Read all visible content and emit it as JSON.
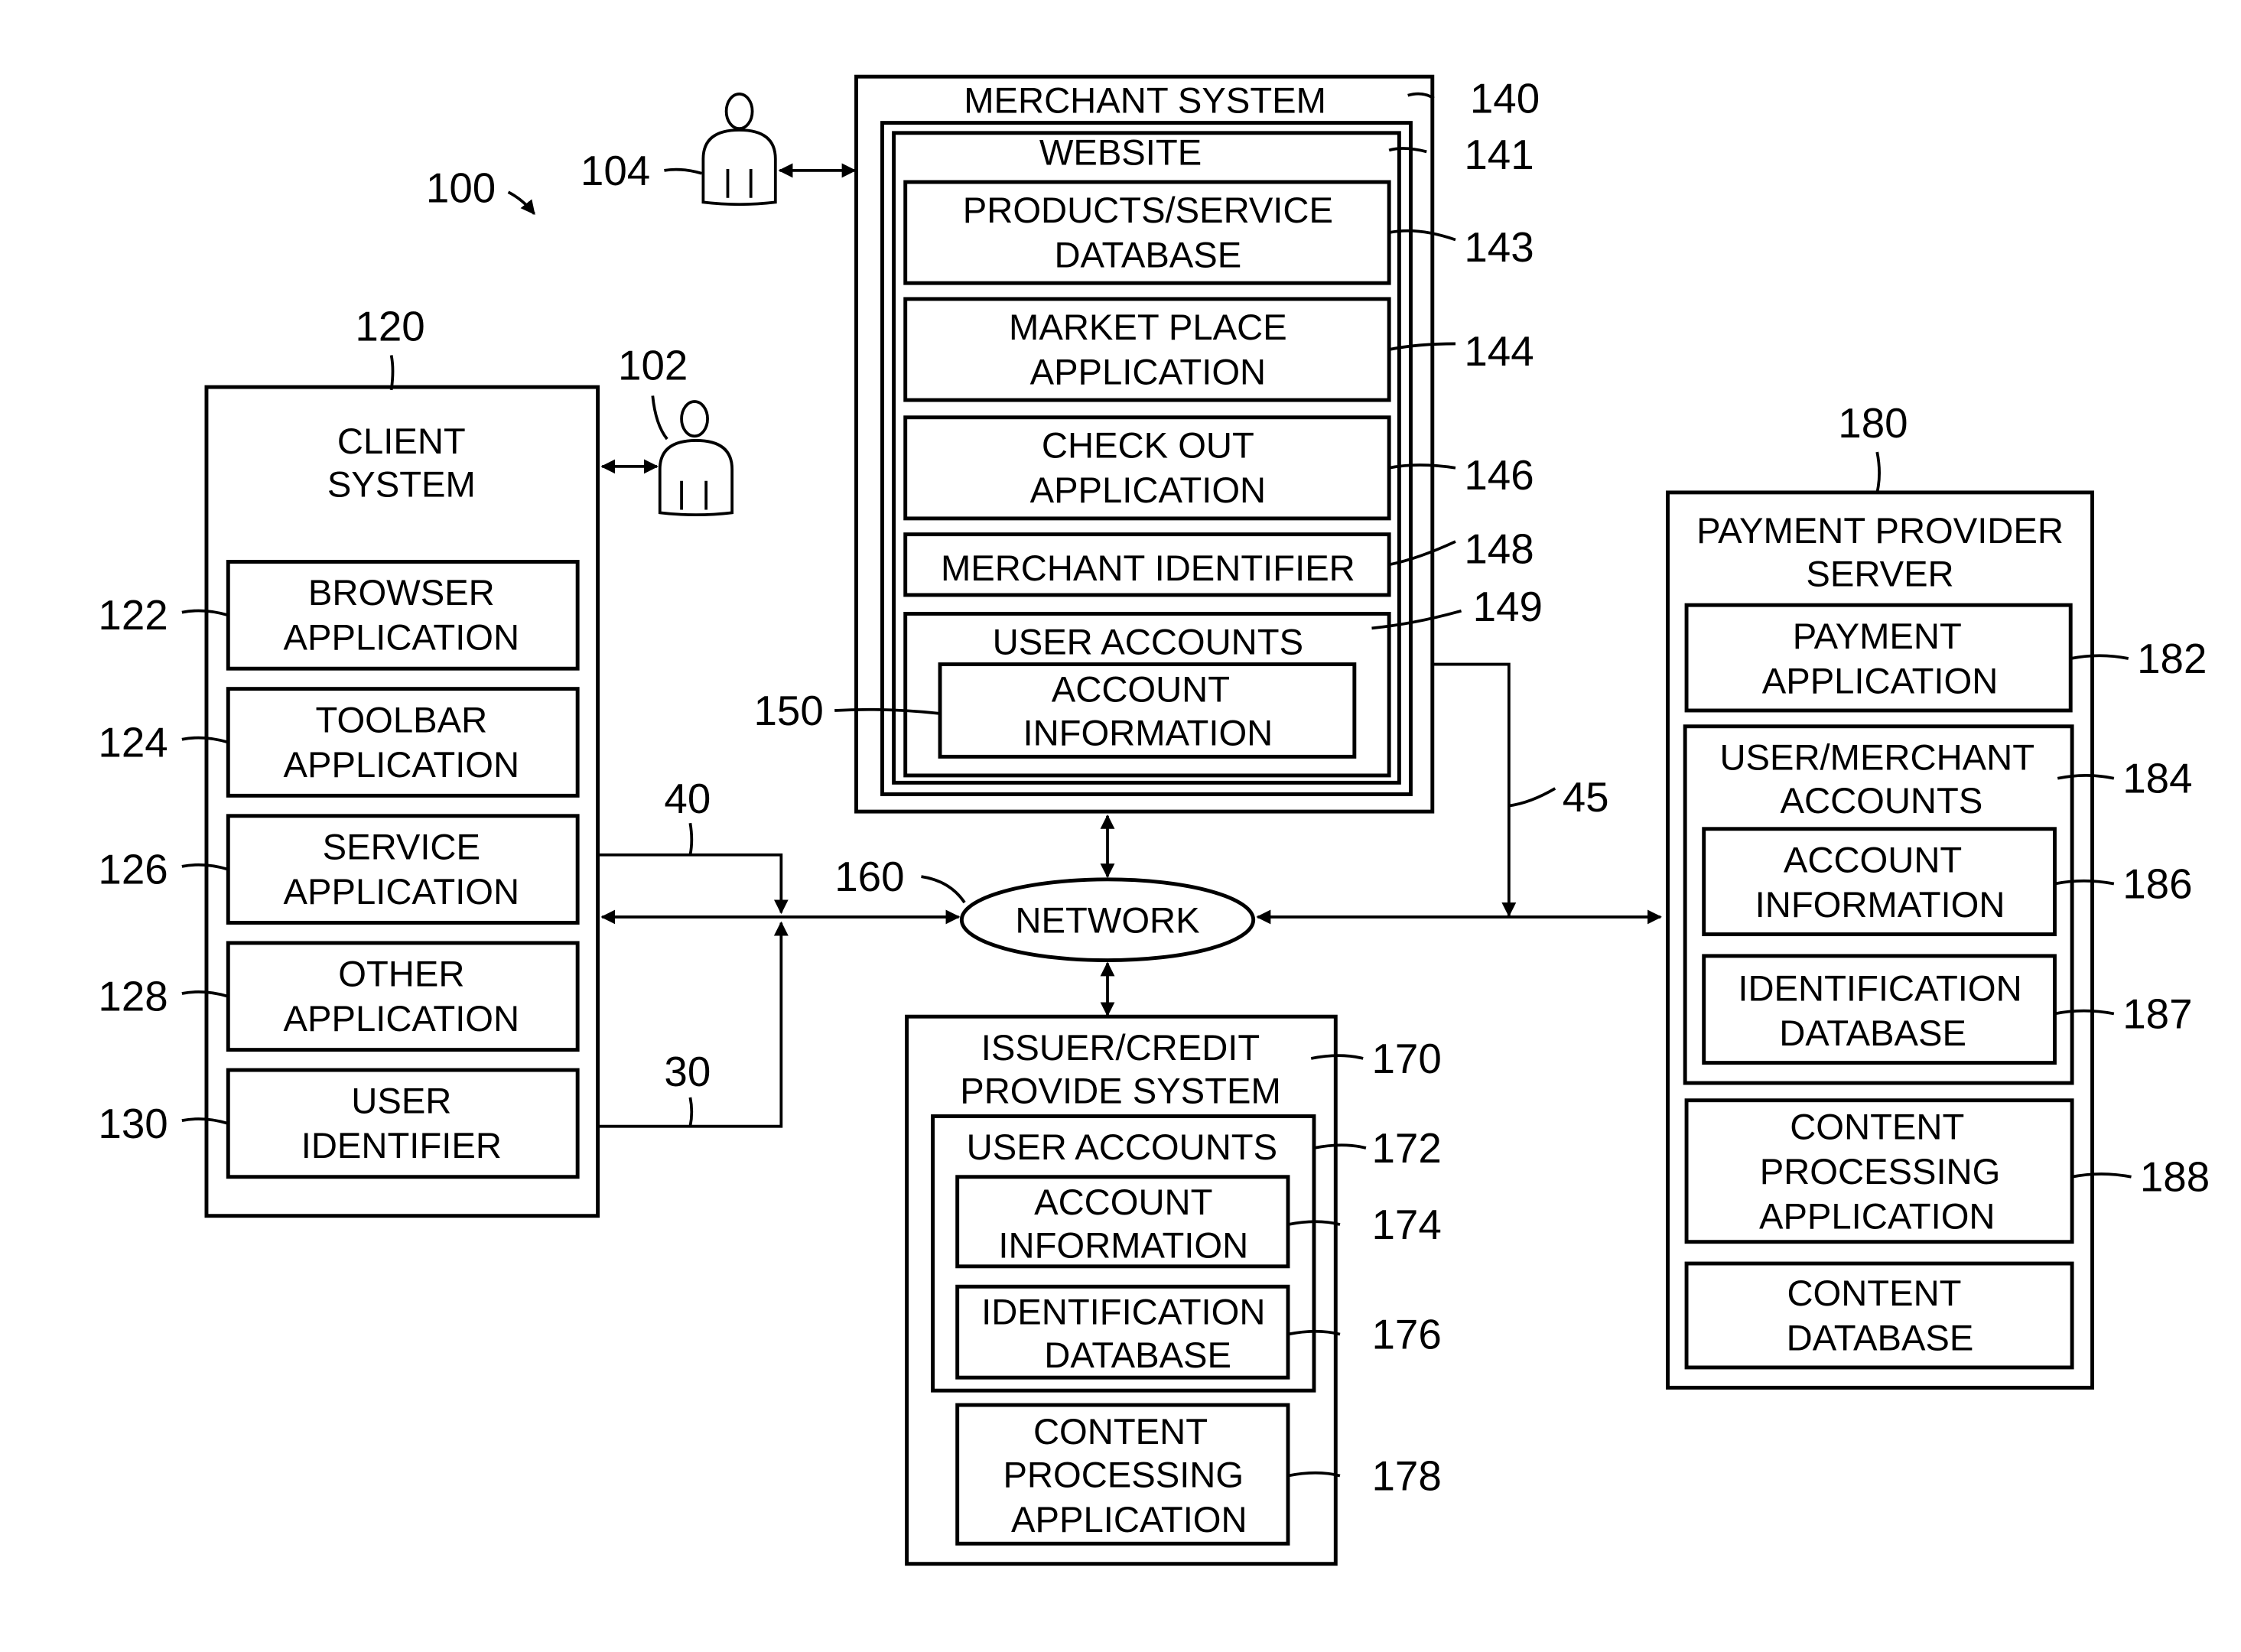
{
  "figure_ref": "100",
  "users": [
    {
      "ref": "104"
    },
    {
      "ref": "102"
    }
  ],
  "client": {
    "ref": "120",
    "title": [
      "CLIENT",
      "SYSTEM"
    ],
    "items": [
      {
        "ref": "122",
        "lines": [
          "BROWSER",
          "APPLICATION"
        ]
      },
      {
        "ref": "124",
        "lines": [
          "TOOLBAR",
          "APPLICATION"
        ]
      },
      {
        "ref": "126",
        "lines": [
          "SERVICE",
          "APPLICATION"
        ]
      },
      {
        "ref": "128",
        "lines": [
          "OTHER",
          "APPLICATION"
        ]
      },
      {
        "ref": "130",
        "lines": [
          "USER",
          "IDENTIFIER"
        ]
      }
    ]
  },
  "merchant": {
    "ref": "140",
    "title": "MERCHANT SYSTEM",
    "website": {
      "ref": "141",
      "title": "WEBSITE"
    },
    "items": [
      {
        "ref": "143",
        "lines": [
          "PRODUCTS/SERVICE",
          "DATABASE"
        ]
      },
      {
        "ref": "144",
        "lines": [
          "MARKET PLACE",
          "APPLICATION"
        ]
      },
      {
        "ref": "146",
        "lines": [
          "CHECK OUT",
          "APPLICATION"
        ]
      },
      {
        "ref": "148",
        "lines": [
          "MERCHANT IDENTIFIER"
        ]
      }
    ],
    "user_accounts": {
      "ref": "149",
      "title": "USER ACCOUNTS",
      "account_info": {
        "ref": "150",
        "lines": [
          "ACCOUNT",
          "INFORMATION"
        ]
      }
    }
  },
  "network": {
    "ref": "160",
    "label": "NETWORK"
  },
  "links": {
    "a": "40",
    "b": "30",
    "c": "45"
  },
  "issuer": {
    "ref": "170",
    "title": [
      "ISSUER/CREDIT",
      "PROVIDE SYSTEM"
    ],
    "user_accounts": {
      "ref": "172",
      "title": "USER ACCOUNTS"
    },
    "account_info": {
      "ref": "174",
      "lines": [
        "ACCOUNT",
        "INFORMATION"
      ]
    },
    "id_db": {
      "ref": "176",
      "lines": [
        "IDENTIFICATION",
        "DATABASE"
      ]
    },
    "content_proc": {
      "ref": "178",
      "lines": [
        "CONTENT",
        "PROCESSING",
        "APPLICATION"
      ]
    }
  },
  "payment": {
    "ref": "180",
    "title": [
      "PAYMENT PROVIDER",
      "SERVER"
    ],
    "payment_app": {
      "ref": "182",
      "lines": [
        "PAYMENT",
        "APPLICATION"
      ]
    },
    "accounts": {
      "ref": "184",
      "title": [
        "USER/MERCHANT",
        "ACCOUNTS"
      ]
    },
    "account_info": {
      "ref": "186",
      "lines": [
        "ACCOUNT",
        "INFORMATION"
      ]
    },
    "id_db": {
      "ref": "187",
      "lines": [
        "IDENTIFICATION",
        "DATABASE"
      ]
    },
    "content_proc": {
      "ref": "188",
      "lines": [
        "CONTENT",
        "PROCESSING",
        "APPLICATION"
      ]
    },
    "content_db": {
      "lines": [
        "CONTENT",
        "DATABASE"
      ]
    }
  }
}
